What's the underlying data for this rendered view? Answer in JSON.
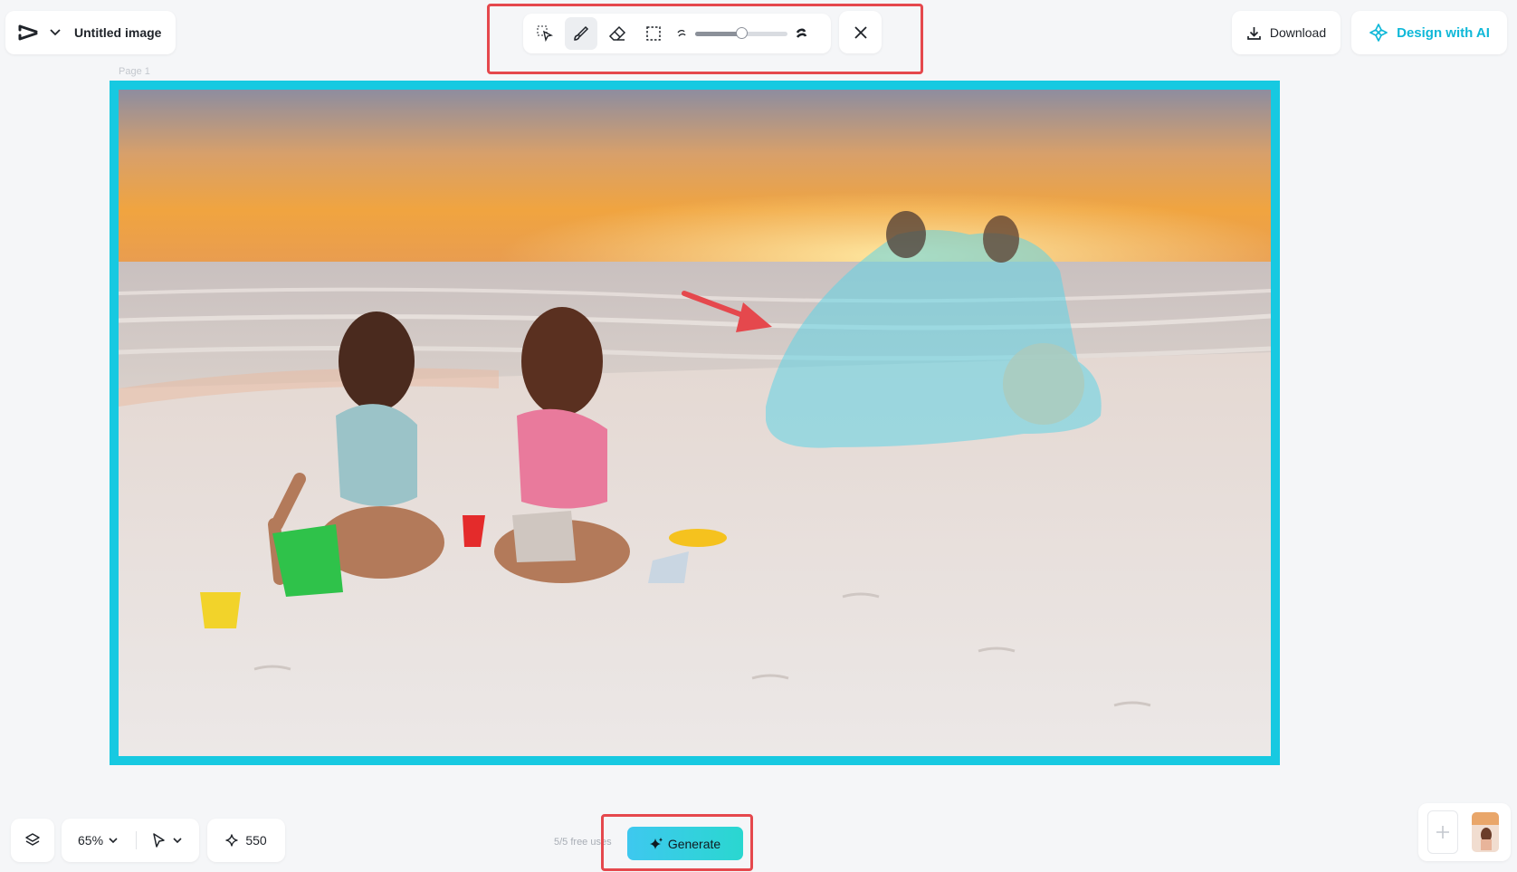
{
  "header": {
    "title": "Untitled image",
    "download_label": "Download",
    "design_ai_label": "Design with AI"
  },
  "toolbar": {
    "tools": [
      "quick-select",
      "brush",
      "eraser",
      "box-select"
    ],
    "active_tool": "brush",
    "brush_size_level": 0.5
  },
  "canvas": {
    "page_label": "Page 1",
    "frame_color": "#17c9e1",
    "selection_color": "#5fd3e6"
  },
  "footer": {
    "zoom": "65%",
    "credits": "550",
    "free_uses": "5/5 free uses",
    "generate_label": "Generate"
  },
  "colors": {
    "accent": "#17c9e1",
    "highlight": "#e5484d"
  }
}
